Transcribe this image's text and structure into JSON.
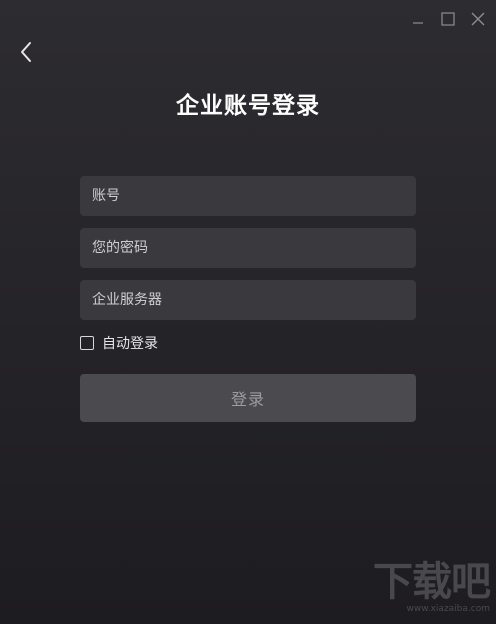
{
  "window": {
    "controls": {
      "minimize": "minimize",
      "maximize": "maximize",
      "close": "close"
    }
  },
  "page": {
    "title": "企业账号登录"
  },
  "form": {
    "account_placeholder": "账号",
    "password_placeholder": "您的密码",
    "server_placeholder": "企业服务器",
    "auto_login_label": "自动登录",
    "auto_login_checked": false,
    "login_button": "登录"
  },
  "watermark": {
    "text": "下载吧",
    "url": "www.xiazaiba.com"
  },
  "colors": {
    "background_top": "#2d2c30",
    "background_bottom": "#1d1c20",
    "field_bg": "#3a393d",
    "button_bg": "#4b4a4e",
    "button_text": "#9d9ca0"
  }
}
